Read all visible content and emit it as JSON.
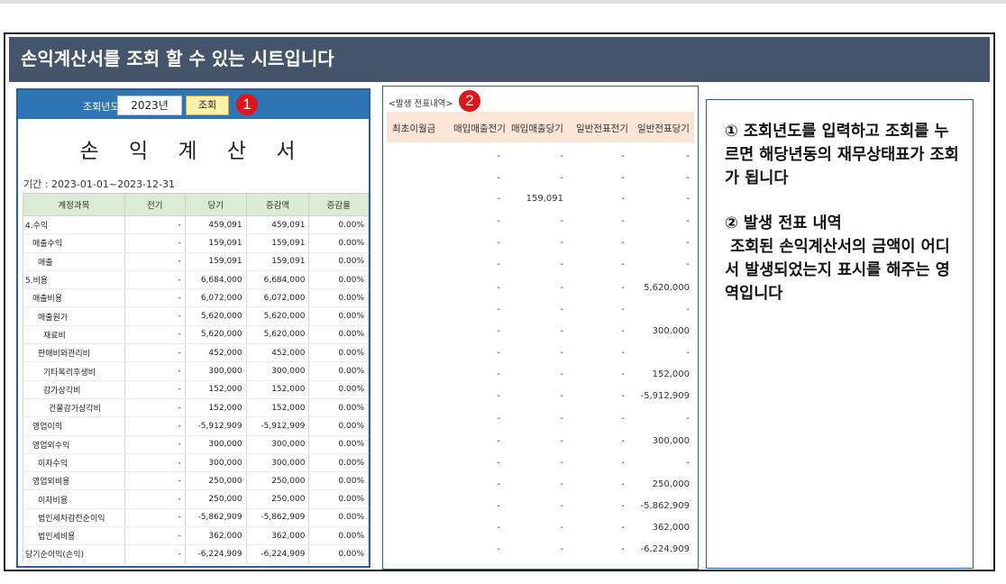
{
  "banner": {
    "title": "손익계산서를 조회 할 수 있는 시트입니다"
  },
  "badges": {
    "one": "1",
    "two": "2"
  },
  "panel1": {
    "year_label": "조회년도",
    "year_value": "2023년",
    "lookup_button": "조회",
    "title": "손 익 계 산 서",
    "period": "기간 : 2023-01-01~2023-12-31",
    "columns": [
      "계정과목",
      "전기",
      "당기",
      "증감액",
      "증감율"
    ],
    "rows": [
      {
        "account": "4.수익",
        "prev": "-",
        "curr": "459,091",
        "diff": "459,091",
        "rate": "0.00%"
      },
      {
        "account": "매출수익",
        "prev": "-",
        "curr": "159,091",
        "diff": "159,091",
        "rate": "0.00%"
      },
      {
        "account": "매출",
        "prev": "-",
        "curr": "159,091",
        "diff": "159,091",
        "rate": "0.00%"
      },
      {
        "account": "5.비용",
        "prev": "-",
        "curr": "6,684,000",
        "diff": "6,684,000",
        "rate": "0.00%"
      },
      {
        "account": "매출비용",
        "prev": "-",
        "curr": "6,072,000",
        "diff": "6,072,000",
        "rate": "0.00%"
      },
      {
        "account": "매출원가",
        "prev": "-",
        "curr": "5,620,000",
        "diff": "5,620,000",
        "rate": "0.00%"
      },
      {
        "account": "재료비",
        "prev": "-",
        "curr": "5,620,000",
        "diff": "5,620,000",
        "rate": "0.00%"
      },
      {
        "account": "판매비와관리비",
        "prev": "-",
        "curr": "452,000",
        "diff": "452,000",
        "rate": "0.00%"
      },
      {
        "account": "기타복리후생비",
        "prev": "-",
        "curr": "300,000",
        "diff": "300,000",
        "rate": "0.00%"
      },
      {
        "account": "감가상각비",
        "prev": "-",
        "curr": "152,000",
        "diff": "152,000",
        "rate": "0.00%"
      },
      {
        "account": "건물감가상각비",
        "prev": "-",
        "curr": "152,000",
        "diff": "152,000",
        "rate": "0.00%"
      },
      {
        "account": "영업이익",
        "prev": "-",
        "curr": "-5,912,909",
        "diff": "-5,912,909",
        "rate": "0.00%"
      },
      {
        "account": "영업외수익",
        "prev": "-",
        "curr": "300,000",
        "diff": "300,000",
        "rate": "0.00%"
      },
      {
        "account": "이자수익",
        "prev": "-",
        "curr": "300,000",
        "diff": "300,000",
        "rate": "0.00%"
      },
      {
        "account": "영업외비용",
        "prev": "-",
        "curr": "250,000",
        "diff": "250,000",
        "rate": "0.00%"
      },
      {
        "account": "이자비용",
        "prev": "-",
        "curr": "250,000",
        "diff": "250,000",
        "rate": "0.00%"
      },
      {
        "account": "법인세차감전순이익",
        "prev": "-",
        "curr": "-5,862,909",
        "diff": "-5,862,909",
        "rate": "0.00%"
      },
      {
        "account": "법인세비용",
        "prev": "-",
        "curr": "362,000",
        "diff": "362,000",
        "rate": "0.00%"
      },
      {
        "account": "당기순이익(손익)",
        "prev": "-",
        "curr": "-6,224,909",
        "diff": "-6,224,909",
        "rate": "0.00%"
      }
    ]
  },
  "panel2": {
    "caption": "<발생 전표내역>",
    "columns": [
      "최초이월금",
      "매입매출전기",
      "매입매출당기",
      "일반전표전기",
      "일반전표당기"
    ],
    "rows": [
      [
        "",
        "-",
        "-",
        "-",
        "-"
      ],
      [
        "",
        "-",
        "-",
        "-",
        "-"
      ],
      [
        "",
        "-",
        "159,091",
        "-",
        "-"
      ],
      [
        "",
        "-",
        "-",
        "-",
        "-"
      ],
      [
        "",
        "-",
        "-",
        "-",
        "-"
      ],
      [
        "",
        "-",
        "-",
        "-",
        "-"
      ],
      [
        "",
        "-",
        "-",
        "-",
        "5,620,000"
      ],
      [
        "",
        "-",
        "-",
        "-",
        "-"
      ],
      [
        "",
        "-",
        "-",
        "-",
        "300,000"
      ],
      [
        "",
        "-",
        "-",
        "-",
        "-"
      ],
      [
        "",
        "-",
        "-",
        "-",
        "152,000"
      ],
      [
        "",
        "-",
        "-",
        "-",
        "-5,912,909"
      ],
      [
        "",
        "-",
        "-",
        "-",
        "-"
      ],
      [
        "",
        "-",
        "-",
        "-",
        "300,000"
      ],
      [
        "",
        "-",
        "-",
        "-",
        "-"
      ],
      [
        "",
        "-",
        "-",
        "-",
        "250,000"
      ],
      [
        "",
        "-",
        "-",
        "-",
        "-5,862,909"
      ],
      [
        "",
        "-",
        "-",
        "-",
        "362,000"
      ],
      [
        "",
        "-",
        "-",
        "-",
        "-6,224,909"
      ]
    ]
  },
  "panel3": {
    "para1": "① 조회년도를 입력하고 조회를 누르면 해당년동의 재무상태표가 조회가 됩니다",
    "para2": "② 발생 전표 내역\n 조회된 손익계산서의 금액이 어디서 발생되었는지 표시를 해주는 영역입니다"
  },
  "colors": {
    "banner": "#44546a",
    "panel_header": "#2e75b6",
    "badge": "#e0151c",
    "table_header": "#dcebd3",
    "voucher_header": "#fbe5d6",
    "lookup_button": "#fff2a8"
  }
}
